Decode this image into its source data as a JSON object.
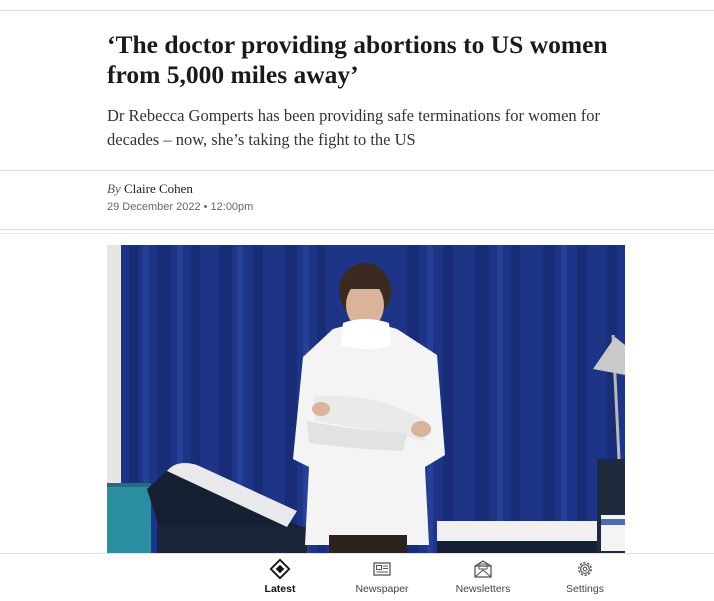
{
  "article": {
    "headline": "‘The doctor providing abortions to US women from 5,000 miles away’",
    "standfirst": "Dr Rebecca Gomperts has been providing safe terminations for women for decades – now, she’s taking the fight to the US",
    "byline_prefix": "By",
    "author": "Claire Cohen",
    "date": "29 December 2022 • 12:00pm"
  },
  "bottom_nav": {
    "items": [
      {
        "label": "Latest",
        "icon": "diamond-icon",
        "active": true
      },
      {
        "label": "Newspaper",
        "icon": "newspaper-icon",
        "active": false
      },
      {
        "label": "Newsletters",
        "icon": "envelope-icon",
        "active": false
      },
      {
        "label": "Settings",
        "icon": "gear-icon",
        "active": false
      }
    ]
  }
}
